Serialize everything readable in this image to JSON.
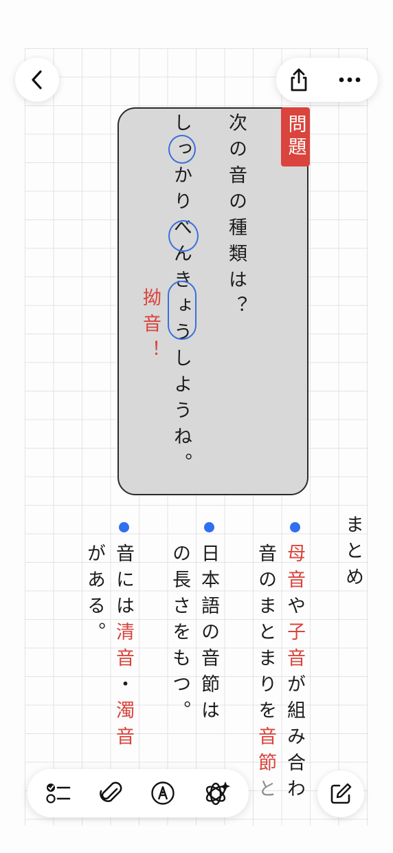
{
  "nav": {
    "back_icon": "chevron-left-icon",
    "share_icon": "share-icon",
    "more_icon": "ellipsis-icon"
  },
  "card": {
    "tag": "問題",
    "col1": "次の音の種類は？",
    "col2_parts": [
      "し",
      "っ",
      "かり",
      "べ",
      "ん",
      "きょ",
      "うしようね。"
    ],
    "annotation": "拗音！",
    "accent_color": "#d9443c",
    "circle_color": "#3a6fd8"
  },
  "summary": {
    "title": "まとめ",
    "b1_c1_parts": [
      "母音",
      "や",
      "子音",
      "が組み合わ"
    ],
    "b1_c2_parts": [
      "音のまとまりを",
      "音節",
      "と"
    ],
    "b2_c1": "日本語の音節は",
    "b2_c2": "の長さをもつ。",
    "b3_c1_parts": [
      "音には",
      "清音",
      "・",
      "濁音"
    ],
    "b3_c2": "がある。",
    "bullet_color": "#2f6ff0"
  },
  "toolbar": {
    "checklist_icon": "checklist-icon",
    "attach_icon": "paperclip-icon",
    "markup_icon": "pen-markup-icon",
    "ai_icon": "apple-intelligence-icon",
    "compose_icon": "compose-icon"
  }
}
